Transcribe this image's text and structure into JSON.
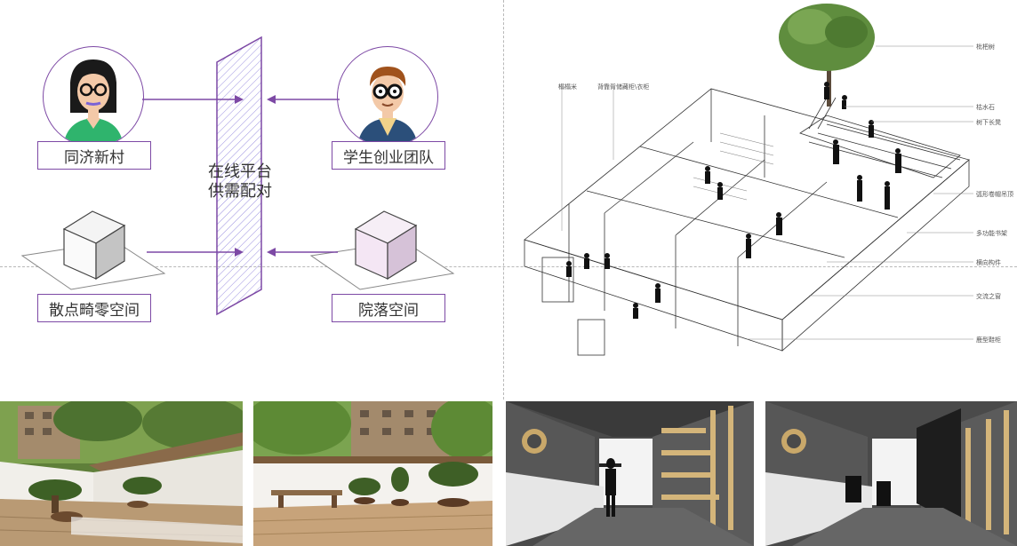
{
  "diagram": {
    "left_top_label": "同济新村",
    "right_top_label": "学生创业团队",
    "left_bottom_label": "散点畸零空间",
    "right_bottom_label": "院落空间",
    "platform_line1": "在线平台",
    "platform_line2": "供需配对"
  },
  "axonometric": {
    "callouts_left": [
      "榻榻米",
      "背靠背储藏柜\\衣柜"
    ],
    "callouts_right": [
      "枇杷树",
      "枯水石",
      "树下长凳",
      "弧形卷帽吊顶",
      "多功能书架",
      "横向构件",
      "交流之窗",
      "鹿型鞋柜"
    ]
  },
  "colors": {
    "accent": "#7d49a5",
    "platform_hatch": "#8a7fd6"
  }
}
